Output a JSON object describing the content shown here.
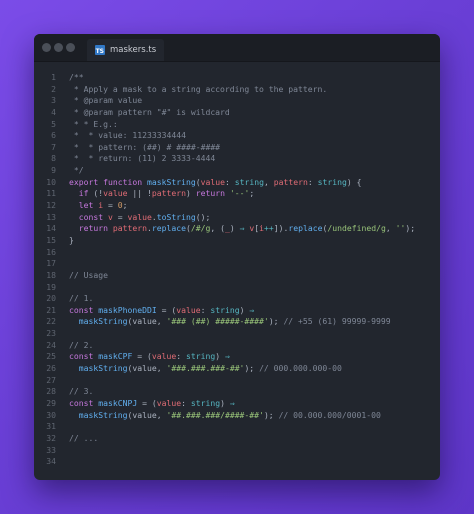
{
  "editor": {
    "tab_label": "maskers.ts",
    "tab_icon": "typescript-file-icon",
    "colors": {
      "background": "#22262e",
      "comment": "#7f8796",
      "keyword": "#c678dd",
      "function": "#61afef",
      "type": "#56b6c2",
      "string": "#98c379",
      "number": "#d19a66",
      "variable": "#e06c75",
      "text": "#abb2bf"
    }
  },
  "lines": [
    {
      "n": "1",
      "tokens": [
        [
          "c",
          "/**"
        ]
      ]
    },
    {
      "n": "2",
      "tokens": [
        [
          "c",
          " * Apply a mask to a string according to the pattern."
        ]
      ]
    },
    {
      "n": "3",
      "tokens": [
        [
          "c",
          " * @param value"
        ]
      ]
    },
    {
      "n": "4",
      "tokens": [
        [
          "c",
          " * @param pattern \"#\" is wildcard"
        ]
      ]
    },
    {
      "n": "5",
      "tokens": [
        [
          "c",
          " * * E.g.:"
        ]
      ]
    },
    {
      "n": "6",
      "tokens": [
        [
          "c",
          " *  * value: 11233334444"
        ]
      ]
    },
    {
      "n": "7",
      "tokens": [
        [
          "c",
          " *  * pattern: (##) # ####-####"
        ]
      ]
    },
    {
      "n": "8",
      "tokens": [
        [
          "c",
          " *  * return: (11) 2 3333-4444"
        ]
      ]
    },
    {
      "n": "9",
      "tokens": [
        [
          "c",
          " */"
        ]
      ]
    },
    {
      "n": "10",
      "tokens": [
        [
          "k",
          "export "
        ],
        [
          "k",
          "function "
        ],
        [
          "f",
          "maskString"
        ],
        [
          "p",
          "("
        ],
        [
          "v",
          "value"
        ],
        [
          "p",
          ": "
        ],
        [
          "t",
          "string"
        ],
        [
          "p",
          ", "
        ],
        [
          "v",
          "pattern"
        ],
        [
          "p",
          ": "
        ],
        [
          "t",
          "string"
        ],
        [
          "p",
          ") {"
        ]
      ]
    },
    {
      "n": "11",
      "tokens": [
        [
          "p",
          "  "
        ],
        [
          "k",
          "if "
        ],
        [
          "p",
          "(!"
        ],
        [
          "v",
          "value"
        ],
        [
          "p",
          " || !"
        ],
        [
          "v",
          "pattern"
        ],
        [
          "p",
          ") "
        ],
        [
          "k",
          "return "
        ],
        [
          "s",
          "'--'"
        ],
        [
          "p",
          ";"
        ]
      ]
    },
    {
      "n": "12",
      "tokens": [
        [
          "p",
          "  "
        ],
        [
          "k",
          "let "
        ],
        [
          "v",
          "i"
        ],
        [
          "p",
          " = "
        ],
        [
          "n",
          "0"
        ],
        [
          "p",
          ";"
        ]
      ]
    },
    {
      "n": "13",
      "tokens": [
        [
          "p",
          "  "
        ],
        [
          "k",
          "const "
        ],
        [
          "v",
          "v"
        ],
        [
          "p",
          " = "
        ],
        [
          "v",
          "value"
        ],
        [
          "p",
          "."
        ],
        [
          "f",
          "toString"
        ],
        [
          "p",
          "();"
        ]
      ]
    },
    {
      "n": "14",
      "tokens": [
        [
          "p",
          "  "
        ],
        [
          "k",
          "return "
        ],
        [
          "v",
          "pattern"
        ],
        [
          "p",
          "."
        ],
        [
          "f",
          "replace"
        ],
        [
          "p",
          "("
        ],
        [
          "s",
          "/#/g"
        ],
        [
          "p",
          ", ("
        ],
        [
          "v",
          "_"
        ],
        [
          "p",
          ") "
        ],
        [
          "o",
          "⇒"
        ],
        [
          "p",
          " "
        ],
        [
          "v",
          "v"
        ],
        [
          "p",
          "["
        ],
        [
          "v",
          "i"
        ],
        [
          "o",
          "++"
        ],
        [
          "p",
          "])."
        ],
        [
          "f",
          "replace"
        ],
        [
          "p",
          "("
        ],
        [
          "s",
          "/undefined/g"
        ],
        [
          "p",
          ", "
        ],
        [
          "s",
          "''"
        ],
        [
          "p",
          ");"
        ]
      ]
    },
    {
      "n": "15",
      "tokens": [
        [
          "p",
          "}"
        ]
      ]
    },
    {
      "n": "16",
      "tokens": []
    },
    {
      "n": "17",
      "tokens": []
    },
    {
      "n": "18",
      "tokens": [
        [
          "c",
          "// Usage"
        ]
      ]
    },
    {
      "n": "19",
      "tokens": []
    },
    {
      "n": "20",
      "tokens": [
        [
          "c",
          "// 1."
        ]
      ]
    },
    {
      "n": "21",
      "tokens": [
        [
          "k",
          "const "
        ],
        [
          "f",
          "maskPhoneDDI"
        ],
        [
          "p",
          " = ("
        ],
        [
          "v",
          "value"
        ],
        [
          "p",
          ": "
        ],
        [
          "t",
          "string"
        ],
        [
          "p",
          ") "
        ],
        [
          "o",
          "⇒"
        ]
      ]
    },
    {
      "n": "22",
      "tokens": [
        [
          "p",
          "  "
        ],
        [
          "f",
          "maskString"
        ],
        [
          "p",
          "(value, "
        ],
        [
          "s",
          "'### (##) #####-####'"
        ],
        [
          "p",
          "); "
        ],
        [
          "c",
          "// +55 (61) 99999-9999"
        ]
      ]
    },
    {
      "n": "23",
      "tokens": []
    },
    {
      "n": "24",
      "tokens": [
        [
          "c",
          "// 2."
        ]
      ]
    },
    {
      "n": "25",
      "tokens": [
        [
          "k",
          "const "
        ],
        [
          "f",
          "maskCPF"
        ],
        [
          "p",
          " = ("
        ],
        [
          "v",
          "value"
        ],
        [
          "p",
          ": "
        ],
        [
          "t",
          "string"
        ],
        [
          "p",
          ") "
        ],
        [
          "o",
          "⇒"
        ]
      ]
    },
    {
      "n": "26",
      "tokens": [
        [
          "p",
          "  "
        ],
        [
          "f",
          "maskString"
        ],
        [
          "p",
          "(value, "
        ],
        [
          "s",
          "'###.###.###-##'"
        ],
        [
          "p",
          "); "
        ],
        [
          "c",
          "// 000.000.000-00"
        ]
      ]
    },
    {
      "n": "27",
      "tokens": []
    },
    {
      "n": "28",
      "tokens": [
        [
          "c",
          "// 3."
        ]
      ]
    },
    {
      "n": "29",
      "tokens": [
        [
          "k",
          "const "
        ],
        [
          "f",
          "maskCNPJ"
        ],
        [
          "p",
          " = ("
        ],
        [
          "v",
          "value"
        ],
        [
          "p",
          ": "
        ],
        [
          "t",
          "string"
        ],
        [
          "p",
          ") "
        ],
        [
          "o",
          "⇒"
        ]
      ]
    },
    {
      "n": "30",
      "tokens": [
        [
          "p",
          "  "
        ],
        [
          "f",
          "maskString"
        ],
        [
          "p",
          "(value, "
        ],
        [
          "s",
          "'##.###.###/####-##'"
        ],
        [
          "p",
          "); "
        ],
        [
          "c",
          "// 00.000.000/0001-00"
        ]
      ]
    },
    {
      "n": "31",
      "tokens": []
    },
    {
      "n": "32",
      "tokens": [
        [
          "c",
          "// ..."
        ]
      ]
    },
    {
      "n": "33",
      "tokens": []
    },
    {
      "n": "34",
      "tokens": []
    }
  ]
}
